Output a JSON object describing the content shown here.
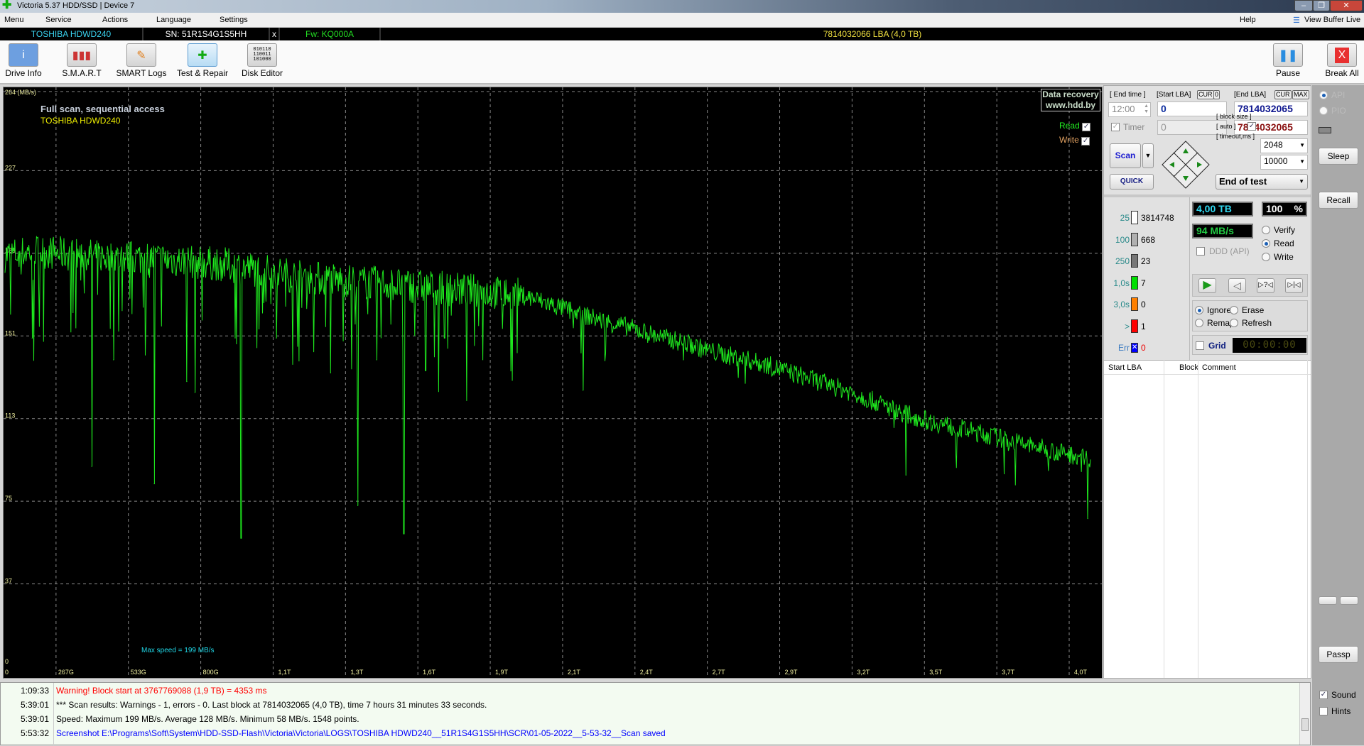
{
  "window": {
    "title": "Victoria 5.37 HDD/SSD | Device 7"
  },
  "menu": {
    "items": [
      "Menu",
      "Service",
      "Actions",
      "Language",
      "Settings"
    ],
    "help": "Help",
    "view_buffer": "View Buffer Live"
  },
  "infobar": {
    "model": "TOSHIBA HDWD240",
    "serial": "SN: 51R1S4G1S5HH",
    "close": "x",
    "firmware": "Fw: KQ000A",
    "capacity": "7814032066 LBA (4,0 TB)"
  },
  "toolbar": {
    "buttons": [
      "Drive Info",
      "S.M.A.R.T",
      "SMART Logs",
      "Test & Repair",
      "Disk Editor"
    ],
    "pause": "Pause",
    "break_all": "Break All"
  },
  "chart_data": {
    "type": "line",
    "title": "Full scan, sequential access",
    "subtitle": "TOSHIBA HDWD240",
    "ylabel": "264 (MB/s)",
    "yticks": [
      "264 (MB/s)",
      "227",
      "189",
      "151",
      "113",
      "75",
      "37",
      "0"
    ],
    "ytick_values": [
      264,
      227,
      189,
      151,
      113,
      75,
      37,
      0
    ],
    "xticks": [
      "0",
      "267G",
      "533G",
      "800G",
      "1,1T",
      "1,3T",
      "1,6T",
      "1,9T",
      "2,1T",
      "2,4T",
      "2,7T",
      "2,9T",
      "3,2T",
      "3,5T",
      "3,7T",
      "4,0T"
    ],
    "xlim": [
      0,
      4.0
    ],
    "ylim": [
      0,
      264
    ],
    "annotation": "Max speed = 199 MB/s",
    "watermark": [
      "Data recovery",
      "www.hdd.by"
    ],
    "legend": [
      {
        "name": "Read",
        "checked": true,
        "color": "#22dd22"
      },
      {
        "name": "Write",
        "checked": true,
        "color": "#e0a060"
      }
    ],
    "grid": true,
    "series": [
      {
        "name": "Read",
        "color": "#1ee81e",
        "x_tb": [
          0,
          0.1,
          0.2,
          0.3,
          0.4,
          0.5,
          0.6,
          0.7,
          0.8,
          0.9,
          1.0,
          1.1,
          1.2,
          1.3,
          1.4,
          1.5,
          1.6,
          1.7,
          1.8,
          1.9,
          2.0,
          2.1,
          2.2,
          2.3,
          2.4,
          2.5,
          2.6,
          2.7,
          2.8,
          2.9,
          3.0,
          3.1,
          3.2,
          3.3,
          3.4,
          3.5,
          3.6,
          3.7,
          3.8,
          3.9,
          4.0
        ],
        "mbps": [
          188,
          190,
          189,
          188,
          187,
          187,
          186,
          185,
          184,
          182,
          180,
          178,
          177,
          176,
          175,
          174,
          173,
          172,
          171,
          170,
          166,
          162,
          158,
          155,
          151,
          148,
          144,
          141,
          138,
          134,
          130,
          126,
          121,
          116,
          112,
          109,
          106,
          103,
          100,
          97,
          95
        ]
      }
    ],
    "dips": [
      [
        0.1,
        150
      ],
      [
        0.32,
        91
      ],
      [
        0.4,
        140
      ],
      [
        0.55,
        83
      ],
      [
        0.67,
        130
      ],
      [
        0.7,
        125
      ],
      [
        0.87,
        58
      ],
      [
        1.0,
        150
      ],
      [
        1.2,
        134
      ],
      [
        1.3,
        73
      ],
      [
        1.37,
        140
      ],
      [
        1.47,
        60
      ],
      [
        1.55,
        135
      ],
      [
        1.62,
        150
      ],
      [
        2.13,
        126
      ],
      [
        2.5,
        140
      ],
      [
        3.32,
        87
      ],
      [
        3.99,
        67
      ]
    ]
  },
  "controls": {
    "end_time_label": "[ End time ]",
    "start_lba_label": "[Start LBA]",
    "cur": "CUR",
    "zero": "0",
    "end_lba_label": "[End LBA]",
    "max": "MAX",
    "end_time": "12:00",
    "start_lba": "0",
    "end_lba": "7814032065",
    "timer_label": "Timer",
    "timer_value": "0",
    "end_lba2": "7814032065",
    "scan": "Scan",
    "quick": "QUICK",
    "block_size_label": "[ block size ]",
    "auto_label": "[ auto ]",
    "timeout_label": "[ timeout,ms ]",
    "block_size": "2048",
    "timeout": "10000",
    "end_action": "End of test"
  },
  "stats": [
    {
      "label": "25",
      "color": "#ffffff",
      "count": "3814748"
    },
    {
      "label": "100",
      "color": "#b0b0b0",
      "count": "668"
    },
    {
      "label": "250",
      "color": "#777777",
      "count": "23"
    },
    {
      "label": "1,0s",
      "color": "#00e000",
      "count": "7"
    },
    {
      "label": "3,0s",
      "color": "#ff8000",
      "count": "0"
    },
    {
      "label": ">",
      "color": "#ff0000",
      "count": "1"
    },
    {
      "label": "Err",
      "color": "#0000ff",
      "count": "0"
    }
  ],
  "status": {
    "size": "4,00 TB",
    "percent": "100",
    "percent_sign": "%",
    "speed": "94 MB/s",
    "ddd": "DDD (API)",
    "timer": "00:00:00",
    "progress": 1.0
  },
  "modes": [
    {
      "label": "Verify",
      "on": false
    },
    {
      "label": "Read",
      "on": true
    },
    {
      "label": "Write",
      "on": false
    }
  ],
  "actions": [
    {
      "label": "Ignore",
      "on": true
    },
    {
      "label": "Erase",
      "on": false
    },
    {
      "label": "Remap",
      "on": false
    },
    {
      "label": "Refresh",
      "on": false
    }
  ],
  "grid_label": "Grid",
  "table": {
    "headers": [
      "Start LBA",
      "Block",
      "Comment"
    ]
  },
  "side": {
    "api": "API",
    "pio": "PIO",
    "sleep": "Sleep",
    "recall": "Recall",
    "passp": "Passp",
    "sound": "Sound",
    "hints": "Hints"
  },
  "log": [
    {
      "time": "1:09:33",
      "text": "Warning! Block start at 3767769088 (1,9 TB)  = 4353 ms",
      "color": "#ff0000"
    },
    {
      "time": "5:39:01",
      "text": "*** Scan results: Warnings - 1, errors - 0. Last block at 7814032065 (4,0 TB), time 7 hours 31 minutes 33 seconds.",
      "color": "#000000"
    },
    {
      "time": "5:39:01",
      "text": "Speed: Maximum 199 MB/s. Average 128 MB/s. Minimum 58 MB/s. 1548 points.",
      "color": "#000000"
    },
    {
      "time": "5:53:32",
      "text": "Screenshot E:\\Programs\\Soft\\System\\HDD-SSD-Flash\\Victoria\\Victoria\\LOGS\\TOSHIBA HDWD240__51R1S4G1S5HH\\SCR\\01-05-2022__5-53-32__Scan saved",
      "color": "#0000ff"
    }
  ]
}
